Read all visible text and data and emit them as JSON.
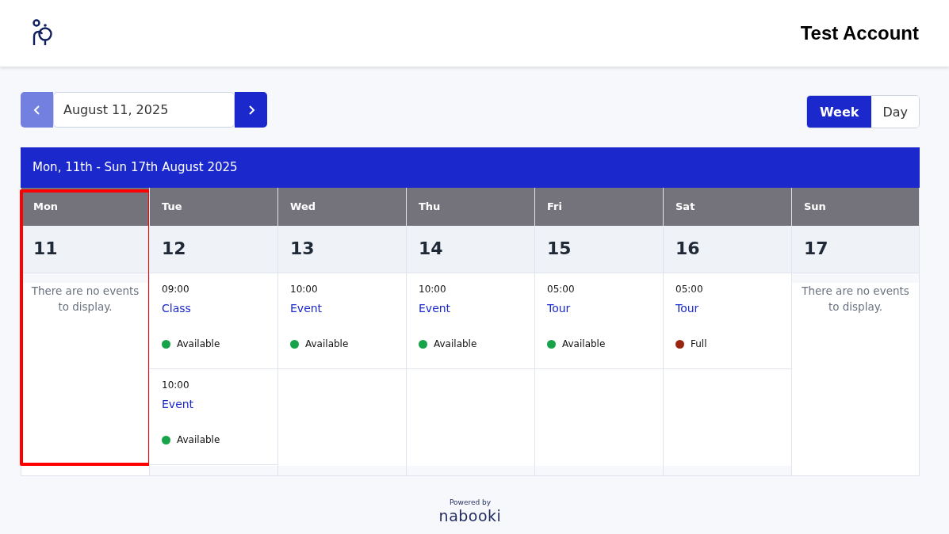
{
  "header": {
    "account": "Test Account"
  },
  "date_picker": {
    "value": "August 11, 2025",
    "prev_disabled": true
  },
  "view_toggle": [
    {
      "label": "Week",
      "selected": true
    },
    {
      "label": "Day",
      "selected": false
    }
  ],
  "week_title": "Mon, 11th - Sun 17th August 2025",
  "days": [
    {
      "name": "Mon",
      "number": "11",
      "highlighted": true,
      "empty_text": "There are no events to display."
    },
    {
      "name": "Tue",
      "number": "12",
      "highlighted": false,
      "events": [
        {
          "time": "09:00",
          "title": "Class",
          "status": "Available",
          "color": "#16a34a"
        },
        {
          "time": "10:00",
          "title": "Event",
          "status": "Available",
          "color": "#16a34a"
        }
      ]
    },
    {
      "name": "Wed",
      "number": "13",
      "highlighted": false,
      "events": [
        {
          "time": "10:00",
          "title": "Event",
          "status": "Available",
          "color": "#16a34a"
        }
      ]
    },
    {
      "name": "Thu",
      "number": "14",
      "highlighted": false,
      "events": [
        {
          "time": "10:00",
          "title": "Event",
          "status": "Available",
          "color": "#16a34a"
        }
      ]
    },
    {
      "name": "Fri",
      "number": "15",
      "highlighted": false,
      "events": [
        {
          "time": "05:00",
          "title": "Tour",
          "status": "Available",
          "color": "#16a34a"
        }
      ]
    },
    {
      "name": "Sat",
      "number": "16",
      "highlighted": false,
      "events": [
        {
          "time": "05:00",
          "title": "Tour",
          "status": "Full",
          "color": "#9a2410"
        }
      ]
    },
    {
      "name": "Sun",
      "number": "17",
      "highlighted": false,
      "empty_text": "There are no events to display."
    }
  ],
  "footer": {
    "powered_by": "Powered by",
    "brand": "nabooki"
  }
}
